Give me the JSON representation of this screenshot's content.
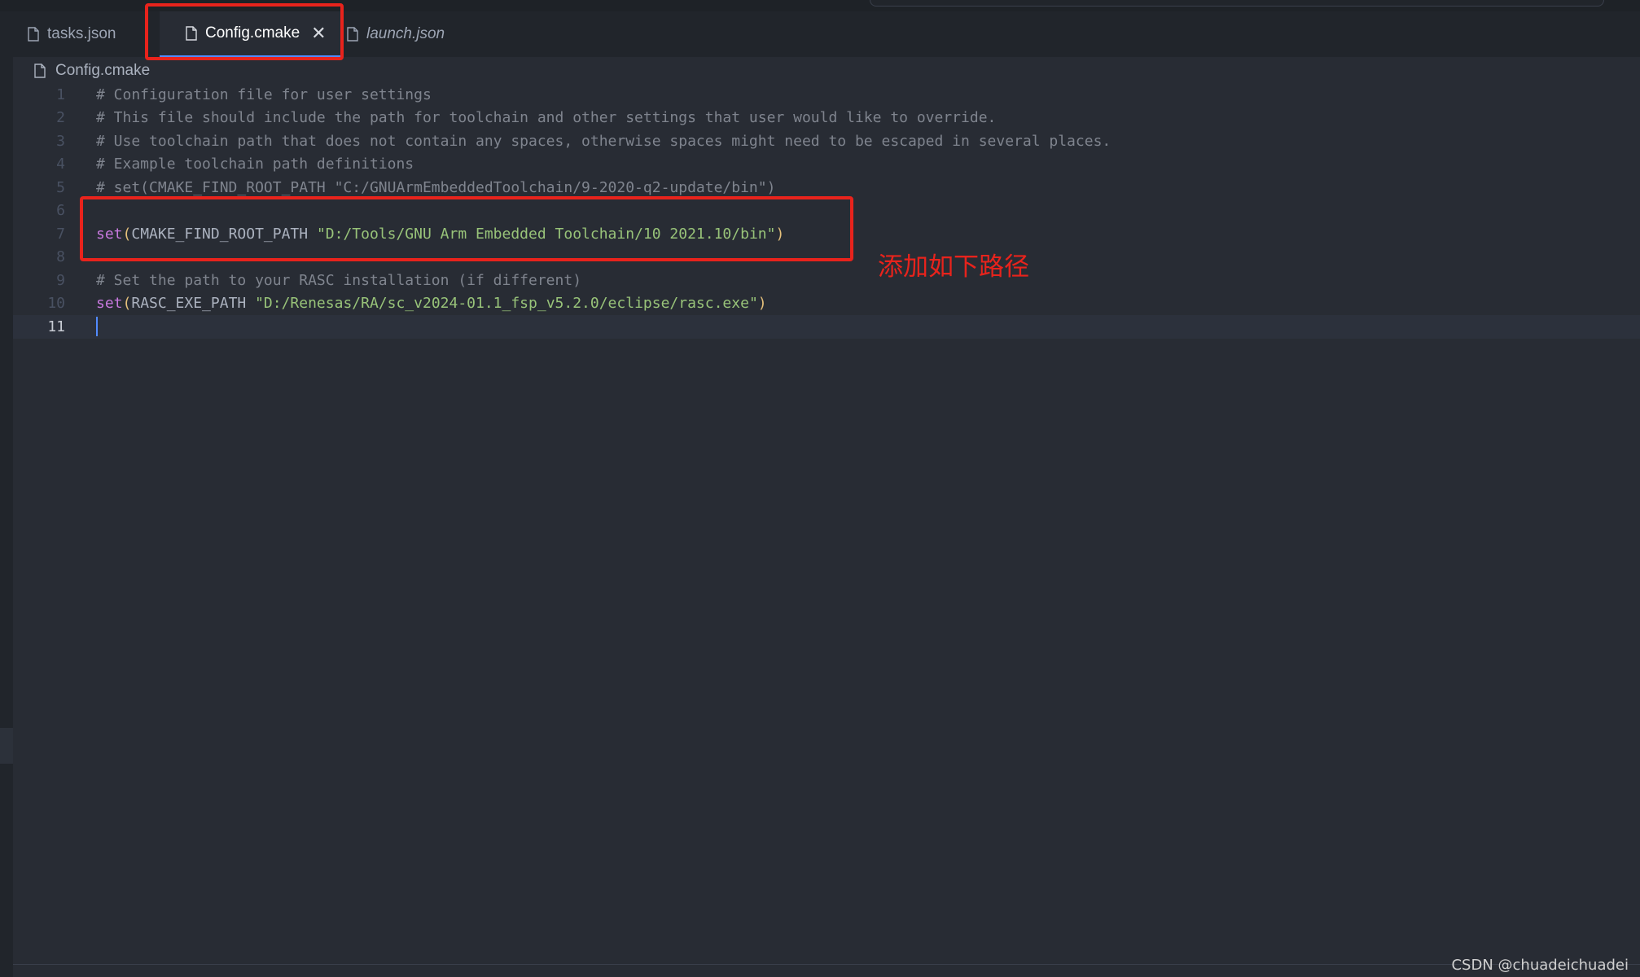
{
  "tabs": [
    {
      "label": "tasks.json",
      "active": false,
      "italic": false
    },
    {
      "label": "Config.cmake",
      "active": true,
      "italic": false,
      "close_glyph": "✕"
    },
    {
      "label": "launch.json",
      "active": false,
      "italic": true
    }
  ],
  "breadcrumb": {
    "file": "Config.cmake",
    "icon": "file-icon"
  },
  "editor": {
    "active_line": 11,
    "lines": [
      {
        "n": "1",
        "segments": [
          {
            "t": "# Configuration file for user settings",
            "k": "comment"
          }
        ]
      },
      {
        "n": "2",
        "segments": [
          {
            "t": "# This file should include the path for toolchain and other settings that user would like to override.",
            "k": "comment"
          }
        ]
      },
      {
        "n": "3",
        "segments": [
          {
            "t": "# Use toolchain path that does not contain any spaces, otherwise spaces might need to be escaped in several places.",
            "k": "comment"
          }
        ]
      },
      {
        "n": "4",
        "segments": [
          {
            "t": "# Example toolchain path definitions",
            "k": "comment"
          }
        ]
      },
      {
        "n": "5",
        "segments": [
          {
            "t": "# set(CMAKE_FIND_ROOT_PATH \"C:/GNUArmEmbeddedToolchain/9-2020-q2-update/bin\")",
            "k": "comment"
          }
        ]
      },
      {
        "n": "6",
        "segments": []
      },
      {
        "n": "7",
        "segments": [
          {
            "t": "set",
            "k": "kw"
          },
          {
            "t": "(",
            "k": "paren"
          },
          {
            "t": "CMAKE_FIND_ROOT_PATH ",
            "k": "plain"
          },
          {
            "t": "\"D:/Tools/GNU Arm Embedded Toolchain/10 2021.10/bin\"",
            "k": "str"
          },
          {
            "t": ")",
            "k": "paren"
          }
        ]
      },
      {
        "n": "8",
        "segments": []
      },
      {
        "n": "9",
        "segments": [
          {
            "t": "# Set the path to your RASC installation (if different)",
            "k": "comment"
          }
        ]
      },
      {
        "n": "10",
        "segments": [
          {
            "t": "set",
            "k": "kw"
          },
          {
            "t": "(",
            "k": "paren"
          },
          {
            "t": "RASC_EXE_PATH ",
            "k": "plain"
          },
          {
            "t": "\"D:/Renesas/RA/sc_v2024-01.1_fsp_v5.2.0/eclipse/rasc.exe\"",
            "k": "str"
          },
          {
            "t": ")",
            "k": "paren"
          }
        ]
      },
      {
        "n": "11",
        "segments": []
      }
    ]
  },
  "annotation": {
    "text": "添加如下路径",
    "color": "#e8231c"
  },
  "watermark": "CSDN @chuadeichuadei",
  "colors": {
    "background": "#282c34",
    "tabbar": "#21252b",
    "comment": "#7f848e",
    "keyword": "#c678dd",
    "string": "#98c379",
    "bracket": "#e5c07b",
    "cursor": "#528bff",
    "highlight_box": "#e8231c"
  }
}
